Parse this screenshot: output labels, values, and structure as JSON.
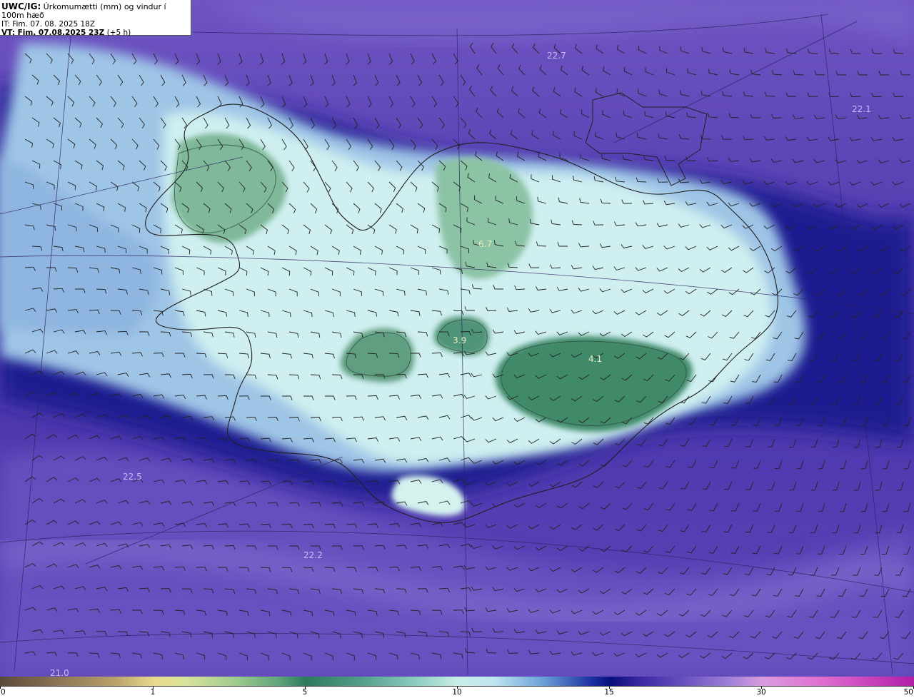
{
  "header": {
    "product": "UWC/IG:",
    "description": "Úrkomumætti (mm) og vindur í 100m hæð",
    "issue_time": "IT: Fim. 07. 08. 2025 18Z",
    "valid_label": "VT: Fim. 07.08.2025 23Z",
    "valid_offset": "(+5 h)"
  },
  "map_labels": [
    {
      "id": "22.7",
      "text": "22.7"
    },
    {
      "id": "22.1",
      "text": "22.1"
    },
    {
      "id": "6.7",
      "text": "6.7"
    },
    {
      "id": "3.9",
      "text": "3.9"
    },
    {
      "id": "4.1",
      "text": "4.1"
    },
    {
      "id": "22.5",
      "text": "22.5"
    },
    {
      "id": "22.2",
      "text": "22.2"
    },
    {
      "id": "21.0",
      "text": "21.0"
    }
  ],
  "colorbar": {
    "unit": "mm",
    "ticks": [
      "0",
      "1",
      "5",
      "10",
      "15",
      "30",
      "50"
    ],
    "colors": {
      "low": "#5a4a3a",
      "yellow": "#e8d98a",
      "green": "#2e7a5e",
      "pale": "#c8eee6",
      "blue": "#1a2da0",
      "purple": "#6b52c0",
      "pink": "#e06ed0"
    }
  },
  "colors": {
    "ocean_purple": "#5a3fb8",
    "dark_band": "#1d1a8a",
    "light_band": "#a9c9e8",
    "land_pale": "#d4f2ee",
    "land_green": "#4f9478",
    "coast": "#222222"
  }
}
